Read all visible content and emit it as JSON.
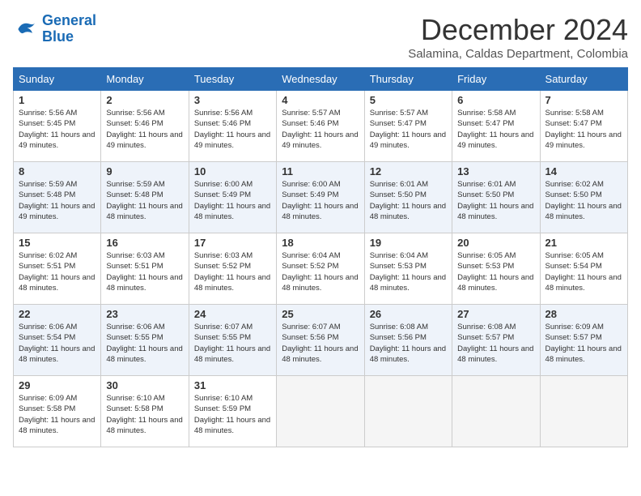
{
  "logo": {
    "line1": "General",
    "line2": "Blue"
  },
  "title": "December 2024",
  "location": "Salamina, Caldas Department, Colombia",
  "days_of_week": [
    "Sunday",
    "Monday",
    "Tuesday",
    "Wednesday",
    "Thursday",
    "Friday",
    "Saturday"
  ],
  "weeks": [
    [
      {
        "day": "1",
        "sunrise": "5:56 AM",
        "sunset": "5:45 PM",
        "daylight": "11 hours and 49 minutes."
      },
      {
        "day": "2",
        "sunrise": "5:56 AM",
        "sunset": "5:46 PM",
        "daylight": "11 hours and 49 minutes."
      },
      {
        "day": "3",
        "sunrise": "5:56 AM",
        "sunset": "5:46 PM",
        "daylight": "11 hours and 49 minutes."
      },
      {
        "day": "4",
        "sunrise": "5:57 AM",
        "sunset": "5:46 PM",
        "daylight": "11 hours and 49 minutes."
      },
      {
        "day": "5",
        "sunrise": "5:57 AM",
        "sunset": "5:47 PM",
        "daylight": "11 hours and 49 minutes."
      },
      {
        "day": "6",
        "sunrise": "5:58 AM",
        "sunset": "5:47 PM",
        "daylight": "11 hours and 49 minutes."
      },
      {
        "day": "7",
        "sunrise": "5:58 AM",
        "sunset": "5:47 PM",
        "daylight": "11 hours and 49 minutes."
      }
    ],
    [
      {
        "day": "8",
        "sunrise": "5:59 AM",
        "sunset": "5:48 PM",
        "daylight": "11 hours and 49 minutes."
      },
      {
        "day": "9",
        "sunrise": "5:59 AM",
        "sunset": "5:48 PM",
        "daylight": "11 hours and 48 minutes."
      },
      {
        "day": "10",
        "sunrise": "6:00 AM",
        "sunset": "5:49 PM",
        "daylight": "11 hours and 48 minutes."
      },
      {
        "day": "11",
        "sunrise": "6:00 AM",
        "sunset": "5:49 PM",
        "daylight": "11 hours and 48 minutes."
      },
      {
        "day": "12",
        "sunrise": "6:01 AM",
        "sunset": "5:50 PM",
        "daylight": "11 hours and 48 minutes."
      },
      {
        "day": "13",
        "sunrise": "6:01 AM",
        "sunset": "5:50 PM",
        "daylight": "11 hours and 48 minutes."
      },
      {
        "day": "14",
        "sunrise": "6:02 AM",
        "sunset": "5:50 PM",
        "daylight": "11 hours and 48 minutes."
      }
    ],
    [
      {
        "day": "15",
        "sunrise": "6:02 AM",
        "sunset": "5:51 PM",
        "daylight": "11 hours and 48 minutes."
      },
      {
        "day": "16",
        "sunrise": "6:03 AM",
        "sunset": "5:51 PM",
        "daylight": "11 hours and 48 minutes."
      },
      {
        "day": "17",
        "sunrise": "6:03 AM",
        "sunset": "5:52 PM",
        "daylight": "11 hours and 48 minutes."
      },
      {
        "day": "18",
        "sunrise": "6:04 AM",
        "sunset": "5:52 PM",
        "daylight": "11 hours and 48 minutes."
      },
      {
        "day": "19",
        "sunrise": "6:04 AM",
        "sunset": "5:53 PM",
        "daylight": "11 hours and 48 minutes."
      },
      {
        "day": "20",
        "sunrise": "6:05 AM",
        "sunset": "5:53 PM",
        "daylight": "11 hours and 48 minutes."
      },
      {
        "day": "21",
        "sunrise": "6:05 AM",
        "sunset": "5:54 PM",
        "daylight": "11 hours and 48 minutes."
      }
    ],
    [
      {
        "day": "22",
        "sunrise": "6:06 AM",
        "sunset": "5:54 PM",
        "daylight": "11 hours and 48 minutes."
      },
      {
        "day": "23",
        "sunrise": "6:06 AM",
        "sunset": "5:55 PM",
        "daylight": "11 hours and 48 minutes."
      },
      {
        "day": "24",
        "sunrise": "6:07 AM",
        "sunset": "5:55 PM",
        "daylight": "11 hours and 48 minutes."
      },
      {
        "day": "25",
        "sunrise": "6:07 AM",
        "sunset": "5:56 PM",
        "daylight": "11 hours and 48 minutes."
      },
      {
        "day": "26",
        "sunrise": "6:08 AM",
        "sunset": "5:56 PM",
        "daylight": "11 hours and 48 minutes."
      },
      {
        "day": "27",
        "sunrise": "6:08 AM",
        "sunset": "5:57 PM",
        "daylight": "11 hours and 48 minutes."
      },
      {
        "day": "28",
        "sunrise": "6:09 AM",
        "sunset": "5:57 PM",
        "daylight": "11 hours and 48 minutes."
      }
    ],
    [
      {
        "day": "29",
        "sunrise": "6:09 AM",
        "sunset": "5:58 PM",
        "daylight": "11 hours and 48 minutes."
      },
      {
        "day": "30",
        "sunrise": "6:10 AM",
        "sunset": "5:58 PM",
        "daylight": "11 hours and 48 minutes."
      },
      {
        "day": "31",
        "sunrise": "6:10 AM",
        "sunset": "5:59 PM",
        "daylight": "11 hours and 48 minutes."
      },
      null,
      null,
      null,
      null
    ]
  ],
  "labels": {
    "sunrise": "Sunrise:",
    "sunset": "Sunset:",
    "daylight": "Daylight:"
  }
}
